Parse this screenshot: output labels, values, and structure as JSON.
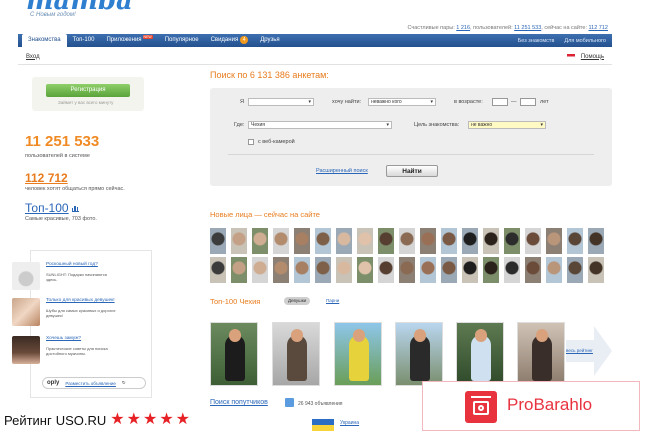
{
  "logo": {
    "wordmark": "mamba",
    "tagline": "С Новым годом!"
  },
  "top_stats": {
    "prefix": "Счастливые пары:",
    "pairs": "1 216",
    "users_label": "пользователей:",
    "users": "11 251 533",
    "online_label": "сейчас на сайте:",
    "online": "112 712"
  },
  "nav": {
    "tabs": [
      {
        "label": "Знакомства",
        "active": true
      },
      {
        "label": "Топ-100"
      },
      {
        "label": "Приложения",
        "badge": "NEW"
      },
      {
        "label": "Популярное"
      },
      {
        "label": "Свидания",
        "count": "4"
      },
      {
        "label": "Друзья"
      }
    ],
    "right": [
      "Без знакомств",
      "Для мобильного"
    ]
  },
  "subbar": {
    "login": "Вход",
    "help": "Помощь"
  },
  "register": {
    "button": "Регистрация",
    "note": "Займет у вас всего минуту"
  },
  "stats": {
    "users_count": "11 251 533",
    "users_label": "пользователей в системе",
    "online_count": "112 712",
    "online_label": "человек хотят общаться прямо сейчас.",
    "top100": "Топ-100",
    "top100_label": "Самые красивые, 703 фото."
  },
  "ads": [
    {
      "title": "Роскошный новый год?",
      "text": "SUNLIGHT: Подарки начинаются здесь."
    },
    {
      "title": "Только для красивых девушек!",
      "text": "Шубы для самых красивых и дорогих девушек!"
    },
    {
      "title": "Хочешь замуж?",
      "text": "Практические советы для поиска достойного мужчины."
    }
  ],
  "oply": {
    "logo": "oply",
    "link": "Разместить объявление"
  },
  "search": {
    "title": "Поиск по 6 131 386 анкетам:",
    "i_label": "Я",
    "i_value": "",
    "want_label": "хочу найти:",
    "want_value": "неважно кого",
    "age_label": "в возрасте:",
    "age_dash": "—",
    "age_unit": "лет",
    "where_label": "Где:",
    "where_value": "Чехия",
    "goal_label": "Цель знакомства:",
    "goal_value": "не важно",
    "webcam_label": "с веб-камерой",
    "advanced": "Расширенный поиск",
    "find_button": "Найти"
  },
  "new_faces": {
    "title": "Новые лица — сейчас на сайте"
  },
  "top100_section": {
    "title": "Топ-100 Чехия",
    "tab_girls": "Девушки",
    "tab_guys": "Парни",
    "all_link": "весь рейтинг"
  },
  "companions": {
    "title": "Поиск попутчиков",
    "count": "26 943 объявления",
    "country": "Украина"
  },
  "overlay": {
    "rating_label": "Рейтинг",
    "site": "USO.RU",
    "stars": 5,
    "star_color": "#e62227",
    "brand": "ProBarahlo",
    "brand_color": "#e8333f"
  }
}
